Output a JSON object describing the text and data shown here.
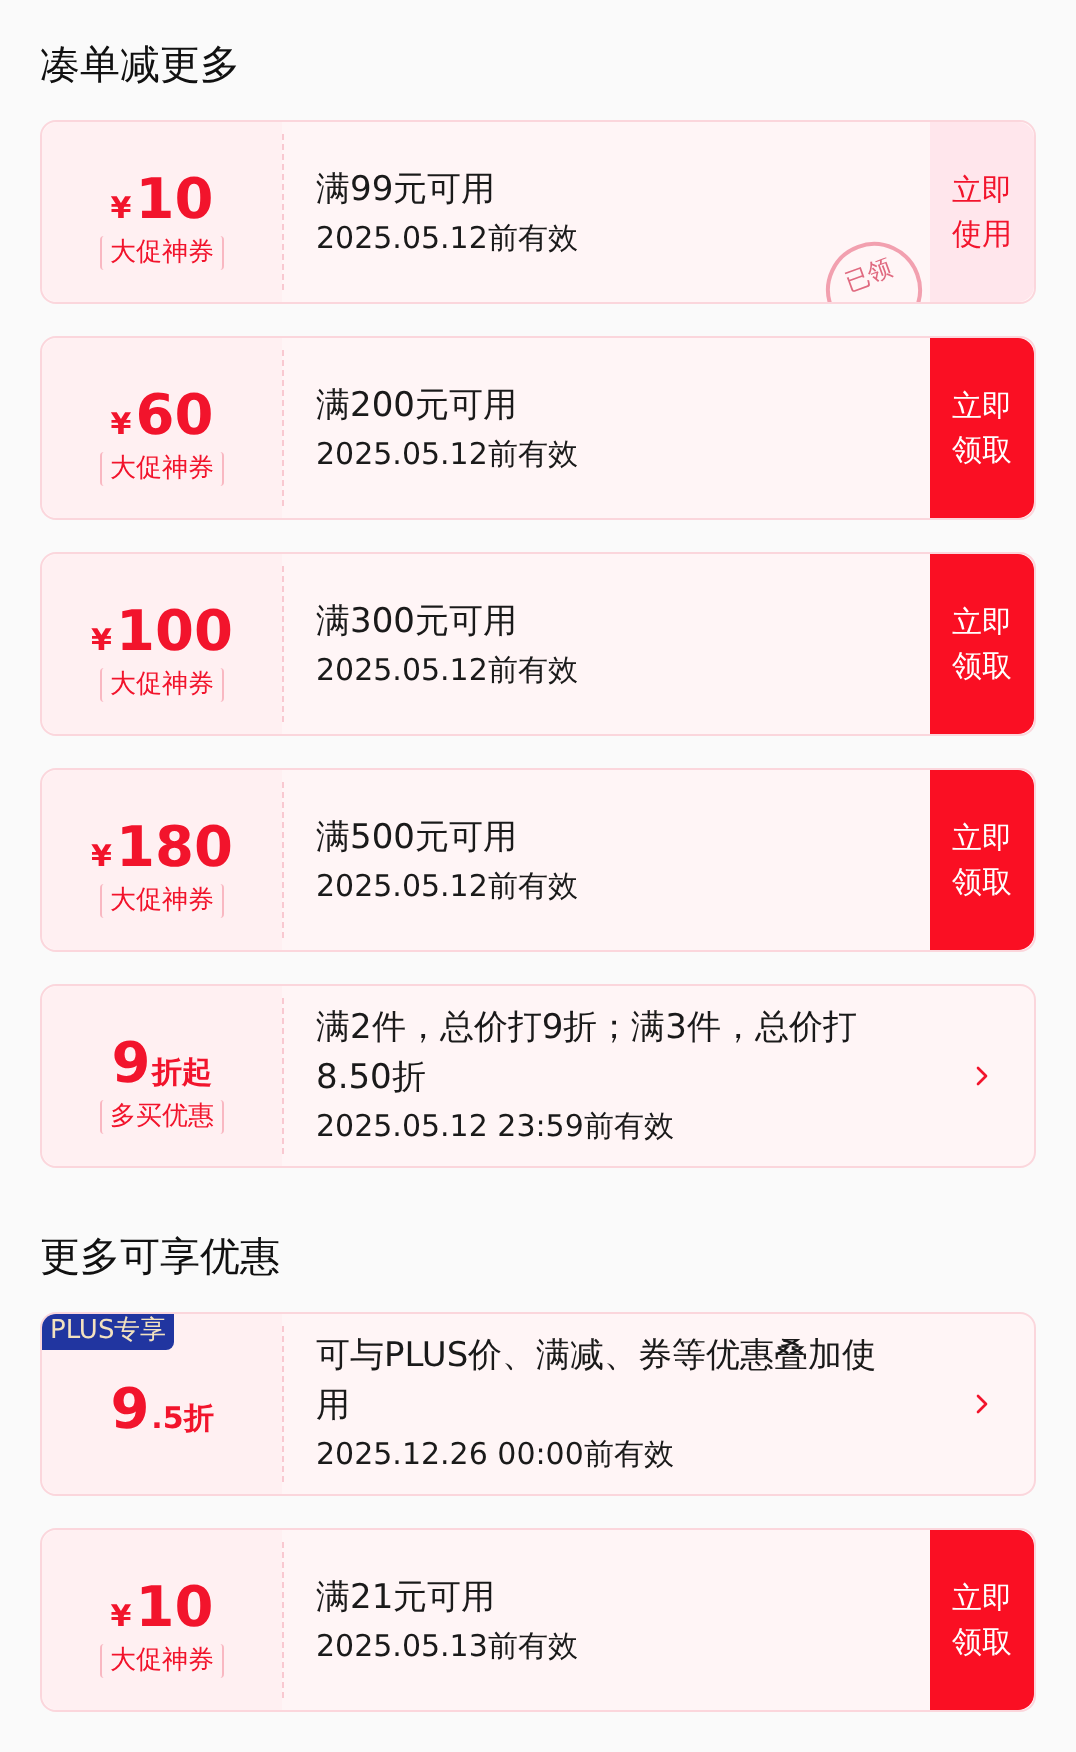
{
  "sections": [
    {
      "title": "凑单减更多",
      "coupons": [
        {
          "value": {
            "prefix": "¥",
            "main": "10"
          },
          "tag": "大促神券",
          "condition": "满99元可用",
          "expiry": "2025.05.12前有效",
          "stamp": "已领",
          "action": {
            "kind": "button",
            "text": "立即使用",
            "claimed": true
          }
        },
        {
          "value": {
            "prefix": "¥",
            "main": "60"
          },
          "tag": "大促神券",
          "condition": "满200元可用",
          "expiry": "2025.05.12前有效",
          "action": {
            "kind": "button",
            "text": "立即领取",
            "claimed": false
          }
        },
        {
          "value": {
            "prefix": "¥",
            "main": "100"
          },
          "tag": "大促神券",
          "condition": "满300元可用",
          "expiry": "2025.05.12前有效",
          "action": {
            "kind": "button",
            "text": "立即领取",
            "claimed": false
          }
        },
        {
          "value": {
            "prefix": "¥",
            "main": "180"
          },
          "tag": "大促神券",
          "condition": "满500元可用",
          "expiry": "2025.05.12前有效",
          "action": {
            "kind": "button",
            "text": "立即领取",
            "claimed": false
          }
        },
        {
          "value": {
            "main": "9",
            "suffix": "折起"
          },
          "tag": "多买优惠",
          "condition": "满2件，总价打9折；满3件，总价打8.50折",
          "expiry": "2025.05.12 23:59前有效",
          "action": {
            "kind": "arrow"
          }
        }
      ]
    },
    {
      "title": "更多可享优惠",
      "coupons": [
        {
          "badge": "PLUS专享",
          "value": {
            "main": "9",
            "suffix": ".5折"
          },
          "condition": "可与PLUS价、满减、券等优惠叠加使用",
          "expiry": "2025.12.26 00:00前有效",
          "action": {
            "kind": "arrow"
          }
        },
        {
          "value": {
            "prefix": "¥",
            "main": "10"
          },
          "tag": "大促神券",
          "condition": "满21元可用",
          "expiry": "2025.05.13前有效",
          "action": {
            "kind": "button",
            "text": "立即领取",
            "claimed": false
          }
        }
      ]
    }
  ]
}
